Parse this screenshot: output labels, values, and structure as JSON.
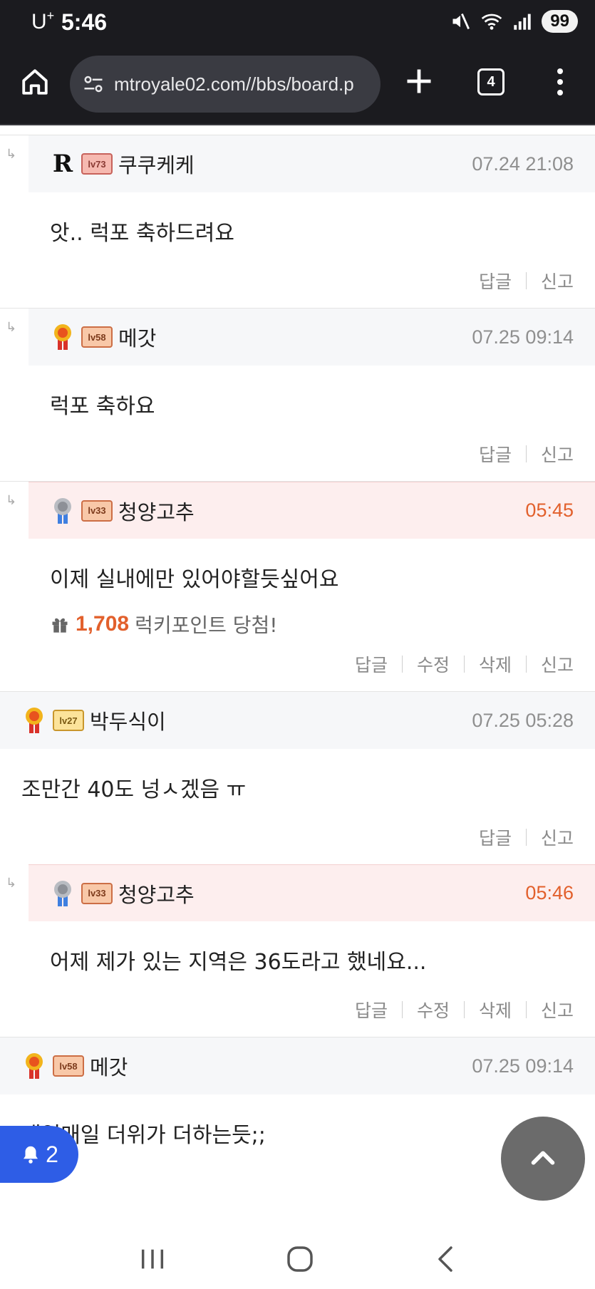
{
  "status_bar": {
    "carrier": "U",
    "carrier_sup": "+",
    "time": "5:46",
    "battery": "99"
  },
  "browser": {
    "url": "mtroyale02.com//bbs/board.p",
    "tab_count": "4"
  },
  "comments": [
    {
      "reply": true,
      "mine": false,
      "badge": "king",
      "level": "lv73",
      "level_style": "red",
      "nickname": "쿠쿠케케",
      "time": "07.24 21:08",
      "body": "앗.. 럭포 축하드려요",
      "actions": [
        "답글",
        "신고"
      ]
    },
    {
      "reply": true,
      "mine": false,
      "badge": "gold-medal",
      "level": "lv58",
      "level_style": "peach",
      "nickname": "메갓",
      "time": "07.25 09:14",
      "body": "럭포 축하요",
      "actions": [
        "답글",
        "신고"
      ]
    },
    {
      "reply": true,
      "mine": true,
      "badge": "silver-medal",
      "level": "lv33",
      "level_style": "peach",
      "nickname": "청양고추",
      "time": "05:45",
      "body": "이제 실내에만 있어야할듯싶어요",
      "reward": {
        "points": "1,708",
        "text": "럭키포인트 당첨!"
      },
      "actions": [
        "답글",
        "수정",
        "삭제",
        "신고"
      ]
    },
    {
      "reply": false,
      "mine": false,
      "badge": "gold-medal",
      "level": "lv27",
      "level_style": "gold",
      "nickname": "박두식이",
      "time": "07.25 05:28",
      "body": "조만간 40도 넝ㅅ겠음 ㅠ",
      "actions": [
        "답글",
        "신고"
      ]
    },
    {
      "reply": true,
      "mine": true,
      "badge": "silver-medal",
      "level": "lv33",
      "level_style": "peach",
      "nickname": "청양고추",
      "time": "05:46",
      "body": "어제 제가 있는 지역은 36도라고 했네요...",
      "actions": [
        "답글",
        "수정",
        "삭제",
        "신고"
      ]
    },
    {
      "reply": false,
      "mine": false,
      "badge": "gold-medal",
      "level": "lv58",
      "level_style": "peach",
      "nickname": "메갓",
      "time": "07.25 09:14",
      "body": "매일매일 더위가 더하는듯;;",
      "actions": []
    }
  ],
  "floating": {
    "notification_count": "2"
  },
  "icons": {
    "home": "home-icon",
    "site_settings": "tune-icon",
    "new_tab": "plus-icon",
    "tabs": "tabs-icon",
    "menu": "more-vertical-icon",
    "bell": "bell-icon",
    "scroll_top": "chevron-up-icon",
    "gift": "gift-icon"
  },
  "colors": {
    "accent": "#e2602c",
    "notif_blue": "#2e5de6",
    "mine_header_bg": "#fdeeee",
    "header_bg": "#f6f7f9"
  }
}
